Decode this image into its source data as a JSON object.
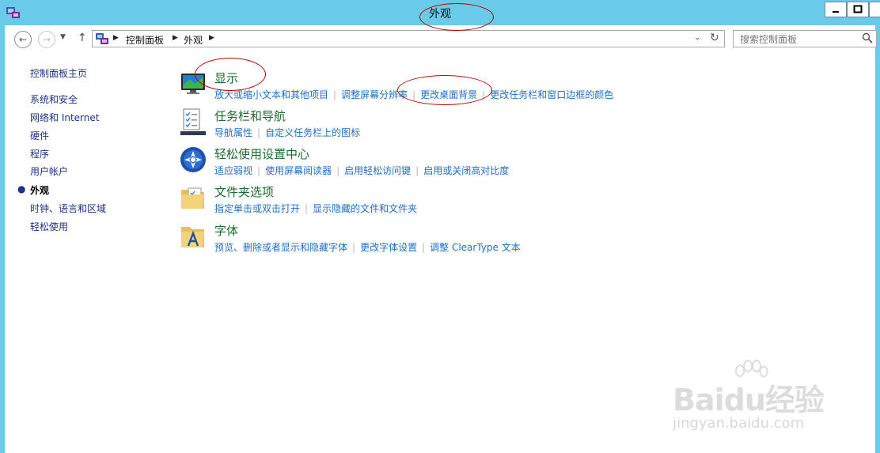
{
  "window": {
    "title": "外观"
  },
  "nav": {
    "breadcrumb": [
      "控制面板",
      "外观"
    ],
    "search_placeholder": "搜索控制面板"
  },
  "sidebar": {
    "home": "控制面板主页",
    "items": [
      "系统和安全",
      "网络和 Internet",
      "硬件",
      "程序",
      "用户帐户",
      "外观",
      "时钟、语言和区域",
      "轻松使用"
    ],
    "current": "外观"
  },
  "categories": [
    {
      "title": "显示",
      "icon": "monitor-icon",
      "links": [
        "放大或缩小文本和其他项目",
        "调整屏幕分辨率",
        "更改桌面背景",
        "更改任务栏和窗口边框的颜色"
      ]
    },
    {
      "title": "任务栏和导航",
      "icon": "taskbar-checklist-icon",
      "links": [
        "导航属性",
        "自定义任务栏上的图标"
      ]
    },
    {
      "title": "轻松使用设置中心",
      "icon": "ease-of-access-icon",
      "links": [
        "适应弱视",
        "使用屏幕阅读器",
        "启用轻松访问键",
        "启用或关闭高对比度"
      ]
    },
    {
      "title": "文件夹选项",
      "icon": "folder-options-icon",
      "links": [
        "指定单击或双击打开",
        "显示隐藏的文件和文件夹"
      ]
    },
    {
      "title": "字体",
      "icon": "fonts-folder-icon",
      "links": [
        "预览、删除或者显示和隐藏字体",
        "更改字体设置",
        "调整 ClearType 文本"
      ]
    }
  ],
  "watermark": {
    "brand": "Baidu经验",
    "url": "jingyan.baidu.com"
  }
}
